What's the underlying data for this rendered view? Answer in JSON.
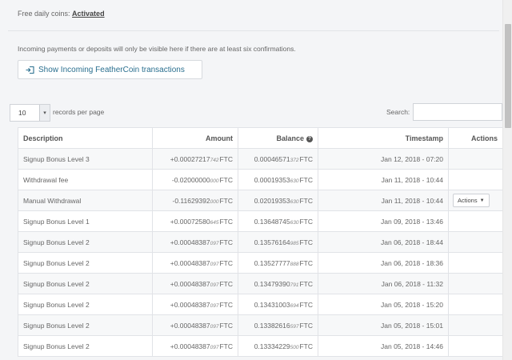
{
  "free_coins": {
    "label": "Free daily coins:",
    "value": "Activated"
  },
  "note": "Incoming payments or deposits will only be visible here if there are at least six confirmations.",
  "show_button": {
    "label": "Show Incoming FeatherCoin transactions",
    "icon": "sign-in-icon"
  },
  "length": {
    "value": "10",
    "label": "records per page"
  },
  "search": {
    "label": "Search:",
    "value": ""
  },
  "table": {
    "headers": {
      "description": "Description",
      "amount": "Amount",
      "balance": "Balance",
      "timestamp": "Timestamp",
      "actions": "Actions"
    },
    "unit": "FTC",
    "actions_button": "Actions",
    "rows": [
      {
        "description": "Signup Bonus Level 3",
        "amount_main": "+0.00027217",
        "amount_frac": "742",
        "balance_main": "0.00046571",
        "balance_frac": "372",
        "timestamp": "Jan 12, 2018 - 07:20",
        "has_action": false
      },
      {
        "description": "Withdrawal fee",
        "amount_main": "-0.02000000",
        "amount_frac": "000",
        "balance_main": "0.00019353",
        "balance_frac": "630",
        "timestamp": "Jan 11, 2018 - 10:44",
        "has_action": false
      },
      {
        "description": "Manual Withdrawal",
        "amount_main": "-0.11629392",
        "amount_frac": "000",
        "balance_main": "0.02019353",
        "balance_frac": "630",
        "timestamp": "Jan 11, 2018 - 10:44",
        "has_action": true
      },
      {
        "description": "Signup Bonus Level 1",
        "amount_main": "+0.00072580",
        "amount_frac": "645",
        "balance_main": "0.13648745",
        "balance_frac": "630",
        "timestamp": "Jan 09, 2018 - 13:46",
        "has_action": false
      },
      {
        "description": "Signup Bonus Level 2",
        "amount_main": "+0.00048387",
        "amount_frac": "097",
        "balance_main": "0.13576164",
        "balance_frac": "985",
        "timestamp": "Jan 06, 2018 - 18:44",
        "has_action": false
      },
      {
        "description": "Signup Bonus Level 2",
        "amount_main": "+0.00048387",
        "amount_frac": "097",
        "balance_main": "0.13527777",
        "balance_frac": "888",
        "timestamp": "Jan 06, 2018 - 18:36",
        "has_action": false
      },
      {
        "description": "Signup Bonus Level 2",
        "amount_main": "+0.00048387",
        "amount_frac": "097",
        "balance_main": "0.13479390",
        "balance_frac": "791",
        "timestamp": "Jan 06, 2018 - 11:32",
        "has_action": false
      },
      {
        "description": "Signup Bonus Level 2",
        "amount_main": "+0.00048387",
        "amount_frac": "097",
        "balance_main": "0.13431003",
        "balance_frac": "694",
        "timestamp": "Jan 05, 2018 - 15:20",
        "has_action": false
      },
      {
        "description": "Signup Bonus Level 2",
        "amount_main": "+0.00048387",
        "amount_frac": "097",
        "balance_main": "0.13382616",
        "balance_frac": "597",
        "timestamp": "Jan 05, 2018 - 15:01",
        "has_action": false
      },
      {
        "description": "Signup Bonus Level 2",
        "amount_main": "+0.00048387",
        "amount_frac": "097",
        "balance_main": "0.13334229",
        "balance_frac": "500",
        "timestamp": "Jan 05, 2018 - 14:46",
        "has_action": false
      }
    ]
  }
}
